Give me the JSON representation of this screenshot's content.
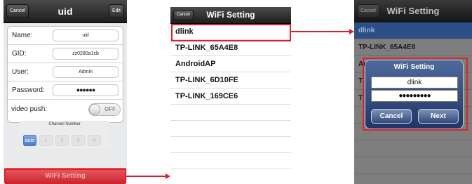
{
  "screen1": {
    "nav": {
      "cancel": "Cancel",
      "title": "uid",
      "edit": "Edit"
    },
    "fields": [
      {
        "label": "Name:",
        "value": "uid"
      },
      {
        "label": "GID:",
        "value": "zz0280a1cb"
      },
      {
        "label": "User:",
        "value": "Admin"
      },
      {
        "label": "Password:",
        "value": "●●●●●●"
      }
    ],
    "video_push": {
      "label": "video push:",
      "toggle": "OFF"
    },
    "channel": {
      "title": "Channel Number",
      "options": [
        "auto",
        "1",
        "2",
        "3",
        "4"
      ],
      "selected": "auto"
    },
    "wifi_button": "WiFi Setting"
  },
  "screen2": {
    "nav": {
      "cancel": "Cancel",
      "title": "WiFi Setting"
    },
    "networks": [
      "dlink",
      "TP-LINK_65A4E8",
      "AndroidAP",
      "TP-LINK_6D10FE",
      "TP-LINK_169CE6"
    ]
  },
  "screen3": {
    "nav": {
      "cancel": "Cancel",
      "title": "WiFi Setting"
    },
    "list": [
      "dlink",
      "TP-LINK_65A4E8",
      "AndroidAP",
      "T",
      "T"
    ],
    "dialog": {
      "title": "WiFi Setting",
      "ssid": "dlink",
      "password": "●●●●●●●●●",
      "cancel": "Cancel",
      "next": "Next"
    }
  },
  "colors": {
    "highlight": "#e02028",
    "selected_row": "#2c4f88",
    "dialog": "#1f3566"
  }
}
